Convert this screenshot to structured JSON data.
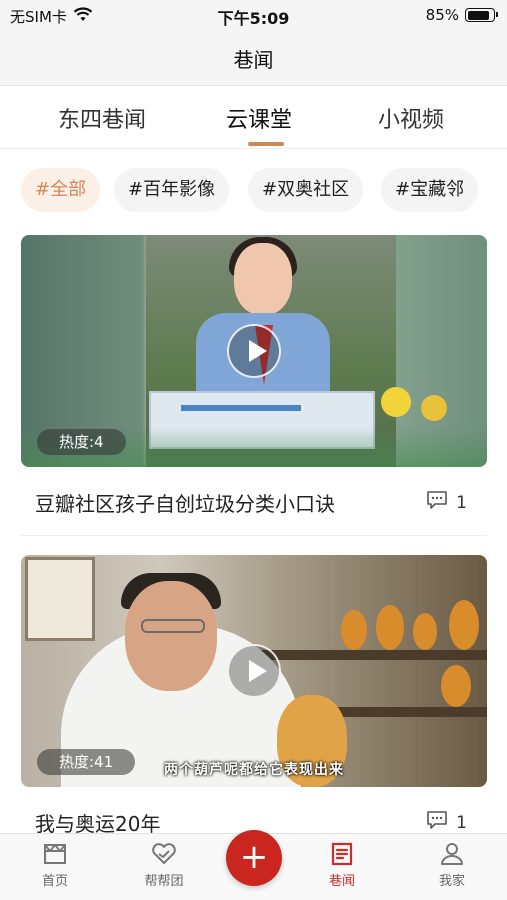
{
  "status_bar": {
    "carrier": "无SIM卡",
    "time": "下午5:09",
    "battery_percent": "85%",
    "battery_level": 0.85
  },
  "header": {
    "title": "巷闻"
  },
  "tabs": [
    {
      "label": "东四巷闻",
      "active": false
    },
    {
      "label": "云课堂",
      "active": true
    },
    {
      "label": "小视频",
      "active": false
    }
  ],
  "chips": [
    {
      "label": "#全部",
      "active": true
    },
    {
      "label": "#百年影像",
      "active": false
    },
    {
      "label": "#双奥社区",
      "active": false
    },
    {
      "label": "#宝藏邻",
      "active": false
    }
  ],
  "videos": [
    {
      "heat": "热度:4",
      "title": "豆瓣社区孩子自创垃圾分类小口诀",
      "comments": "1"
    },
    {
      "heat": "热度:41",
      "title": "我与奥运20年",
      "comments": "1",
      "subtitle_overlay": "两个葫芦呢都给它表现出来"
    }
  ],
  "bottom_nav": [
    {
      "label": "首页",
      "icon": "home-icon",
      "active": false
    },
    {
      "label": "帮帮团",
      "icon": "heart-hand-icon",
      "active": false
    },
    {
      "label": "+",
      "icon": "plus-icon",
      "active": false
    },
    {
      "label": "巷闻",
      "icon": "news-icon",
      "active": true
    },
    {
      "label": "我家",
      "icon": "person-icon",
      "active": false
    }
  ],
  "colors": {
    "accent": "#c8261f",
    "tab_underline": "#c98a55",
    "chip_active_text": "#d9865a"
  }
}
